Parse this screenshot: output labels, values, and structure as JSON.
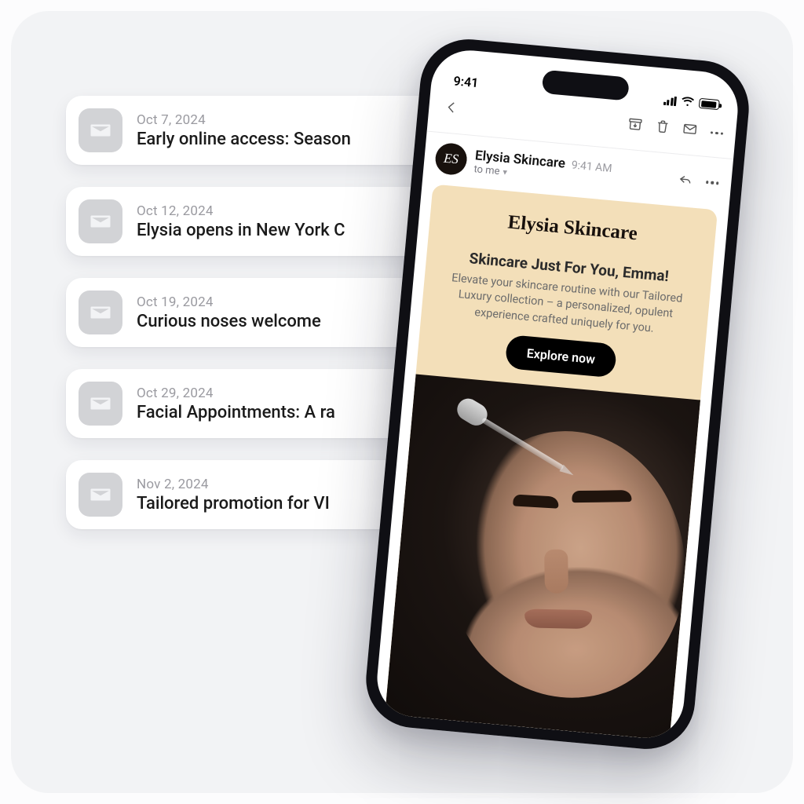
{
  "emails": [
    {
      "date": "Oct 7, 2024",
      "subject": "Early online access: Season"
    },
    {
      "date": "Oct 12, 2024",
      "subject": "Elysia opens in New York C"
    },
    {
      "date": "Oct 19, 2024",
      "subject": "Curious noses welcome"
    },
    {
      "date": "Oct 29, 2024",
      "subject": "Facial Appointments: A ra"
    },
    {
      "date": "Nov 2, 2024",
      "subject": "Tailored promotion for VI"
    }
  ],
  "phone": {
    "status_time": "9:41",
    "sender": {
      "avatar_initials": "ES",
      "name": "Elysia Skincare",
      "time": "9:41 AM",
      "recipient": "to me"
    },
    "email": {
      "brand": "Elysia Skincare",
      "headline": "Skincare Just For You, Emma!",
      "copy": "Elevate your skincare routine with our Tailored Luxury collection – a personalized, opulent experience crafted uniquely for you.",
      "cta": "Explore now"
    }
  }
}
